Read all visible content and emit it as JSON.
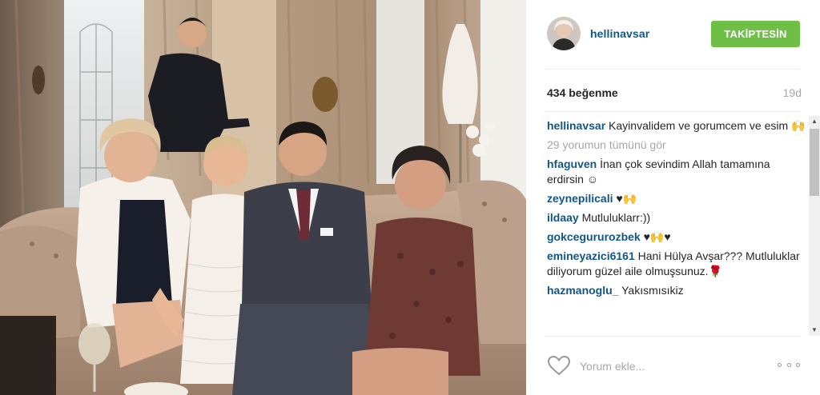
{
  "post": {
    "username": "hellinavsar",
    "follow_label": "TAKİPTESİN",
    "likes": "434 beğenme",
    "time": "19d",
    "view_all": "29 yorumun tümünü gör",
    "caption": {
      "user": "hellinavsar",
      "text": "Kayinvalidem ve gorumcem ve esim 🙌"
    },
    "comments": [
      {
        "user": "hfaguven",
        "text": "İnan çok sevindim Allah tamamına erdirsin ☺"
      },
      {
        "user": "zeynepilicali",
        "text": "♥🙌"
      },
      {
        "user": "ildaay",
        "text": "Mutluluklarr:))"
      },
      {
        "user": "gokcegururozbek",
        "text": "♥🙌♥"
      },
      {
        "user": "emineyazici6161",
        "text": "Hani Hülya Avşar??? Mutluluklar diliyorum güzel aile olmuşsunuz.🌹"
      },
      {
        "user": "hazmanoglu_",
        "text": "Yakısmısıkiz"
      }
    ],
    "comment_placeholder": "Yorum ekle...",
    "icons": {
      "like": "heart-outline-icon",
      "more": "more-options-icon"
    },
    "colors": {
      "username": "#125688",
      "follow_button": "#6fbf47",
      "muted_text": "#a5a7aa"
    }
  }
}
